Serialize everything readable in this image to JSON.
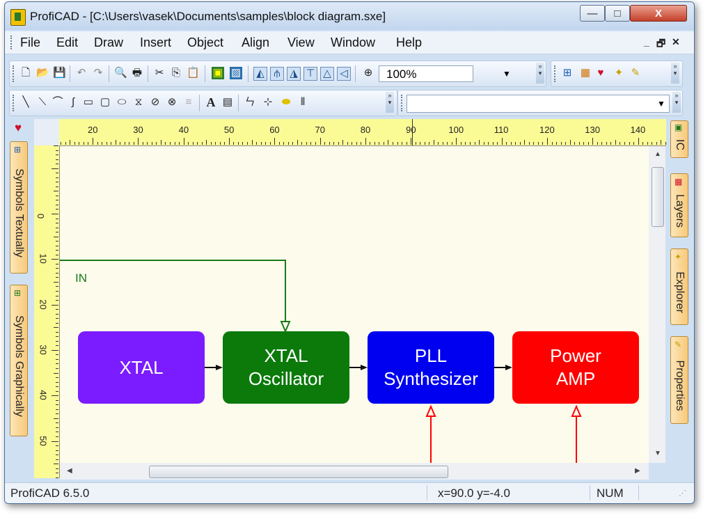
{
  "window": {
    "title": "ProfiCAD - [C:\\Users\\vasek\\Documents\\samples\\block diagram.sxe]",
    "minimize": "—",
    "maximize": "□",
    "close": "X"
  },
  "menu": {
    "items": [
      "File",
      "Edit",
      "Draw",
      "Insert",
      "Object",
      "Align",
      "View",
      "Window",
      "Help"
    ],
    "mdi_minimize": "_",
    "mdi_restore": "🗗",
    "mdi_close": "✕"
  },
  "toolbar1": {
    "zoom": "100%",
    "icons": [
      "new-icon",
      "open-icon",
      "save-icon",
      "undo-icon",
      "redo-icon",
      "print-preview-icon",
      "print-icon",
      "cut-icon",
      "copy-icon",
      "paste-icon",
      "image-icon",
      "picture-icon",
      "align-icons",
      "zoom-icon"
    ]
  },
  "toolbar2": {
    "text_tool": "A",
    "icons": [
      "line-icon",
      "polyline-icon",
      "arc-icon",
      "curve-icon",
      "rectangle-icon",
      "rounded-rect-icon",
      "ellipse-icon",
      "triangle-icon",
      "hatched-ellipse-icon",
      "hatched-circle-icon",
      "list-icon",
      "text-icon",
      "textbox-icon",
      "wire-icon",
      "junction-icon",
      "tag-icon",
      "bus-icon"
    ]
  },
  "left_tabs": [
    "Symbols Textually",
    "Symbols Graphically"
  ],
  "right_tabs": [
    "IC",
    "Layers",
    "Explorer",
    "Properties"
  ],
  "ruler": {
    "h_labels": [
      "20",
      "30",
      "40",
      "50",
      "60",
      "70",
      "80",
      "90",
      "100",
      "110",
      "120",
      "130",
      "140"
    ],
    "v_labels": [
      "0",
      "10",
      "20",
      "30",
      "40",
      "50"
    ]
  },
  "diagram": {
    "input_label": "IN",
    "blocks": [
      {
        "label": "XTAL",
        "color": "#7a1cff"
      },
      {
        "label": "XTAL\nOscillator",
        "color": "#0b7a0b"
      },
      {
        "label": "PLL\nSynthesizer",
        "color": "#0000f0"
      },
      {
        "label": "Power\nAMP",
        "color": "#ff0000"
      }
    ],
    "wire_in_color": "#1a7a1a",
    "wire_ctrl_color": "#ff0000"
  },
  "status": {
    "version": "ProfiCAD 6.5.0",
    "coords": "x=90.0  y=-4.0",
    "num": "NUM"
  }
}
